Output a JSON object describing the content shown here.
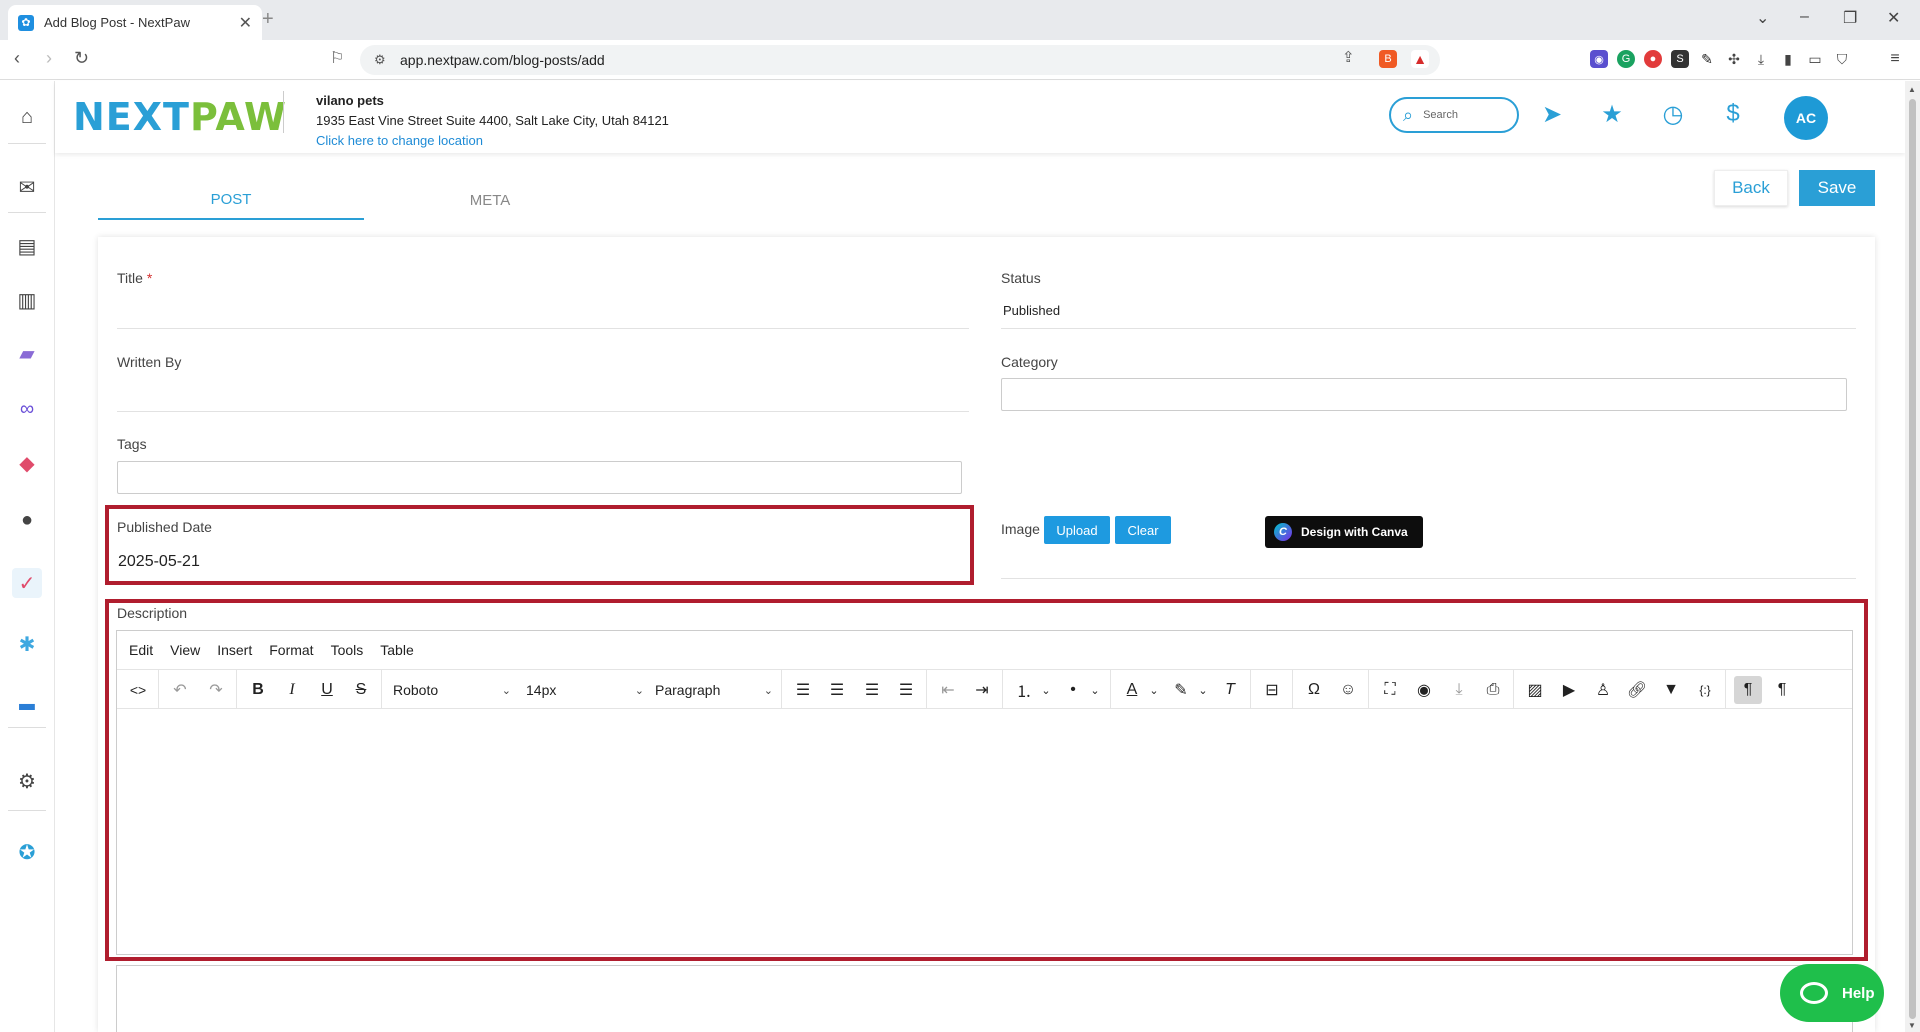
{
  "browser": {
    "tab_title": "Add Blog Post - NextPaw",
    "url": "app.nextpaw.com/blog-posts/add"
  },
  "header": {
    "logo_next": "NEXT",
    "logo_paw": "PAW",
    "location_name": "vilano pets",
    "location_address": "1935 East Vine Street Suite 4400, Salt Lake City, Utah 84121",
    "location_link": "Click here to change location",
    "search_placeholder": "Search",
    "avatar_initials": "AC"
  },
  "tabs": {
    "post": "POST",
    "meta": "META"
  },
  "actions": {
    "back": "Back",
    "save": "Save"
  },
  "form": {
    "title_label": "Title",
    "title_required": "*",
    "title_value": "",
    "status_label": "Status",
    "status_value": "Published",
    "written_by_label": "Written By",
    "written_by_value": "",
    "category_label": "Category",
    "tags_label": "Tags",
    "published_date_label": "Published Date",
    "published_date_value": "2025-05-21",
    "image_label": "Image",
    "upload_button": "Upload",
    "clear_button": "Clear",
    "canva_button": "Design with Canva",
    "description_label": "Description"
  },
  "editor": {
    "menu": [
      "Edit",
      "View",
      "Insert",
      "Format",
      "Tools",
      "Table"
    ],
    "font_family": "Roboto",
    "font_size": "14px",
    "block_format": "Paragraph"
  },
  "help": {
    "label": "Help"
  },
  "colors": {
    "brand_blue": "#2a9fd6",
    "brand_green": "#7bbf3b",
    "highlight_red": "#b01d2e",
    "help_green": "#1fbf4b"
  }
}
